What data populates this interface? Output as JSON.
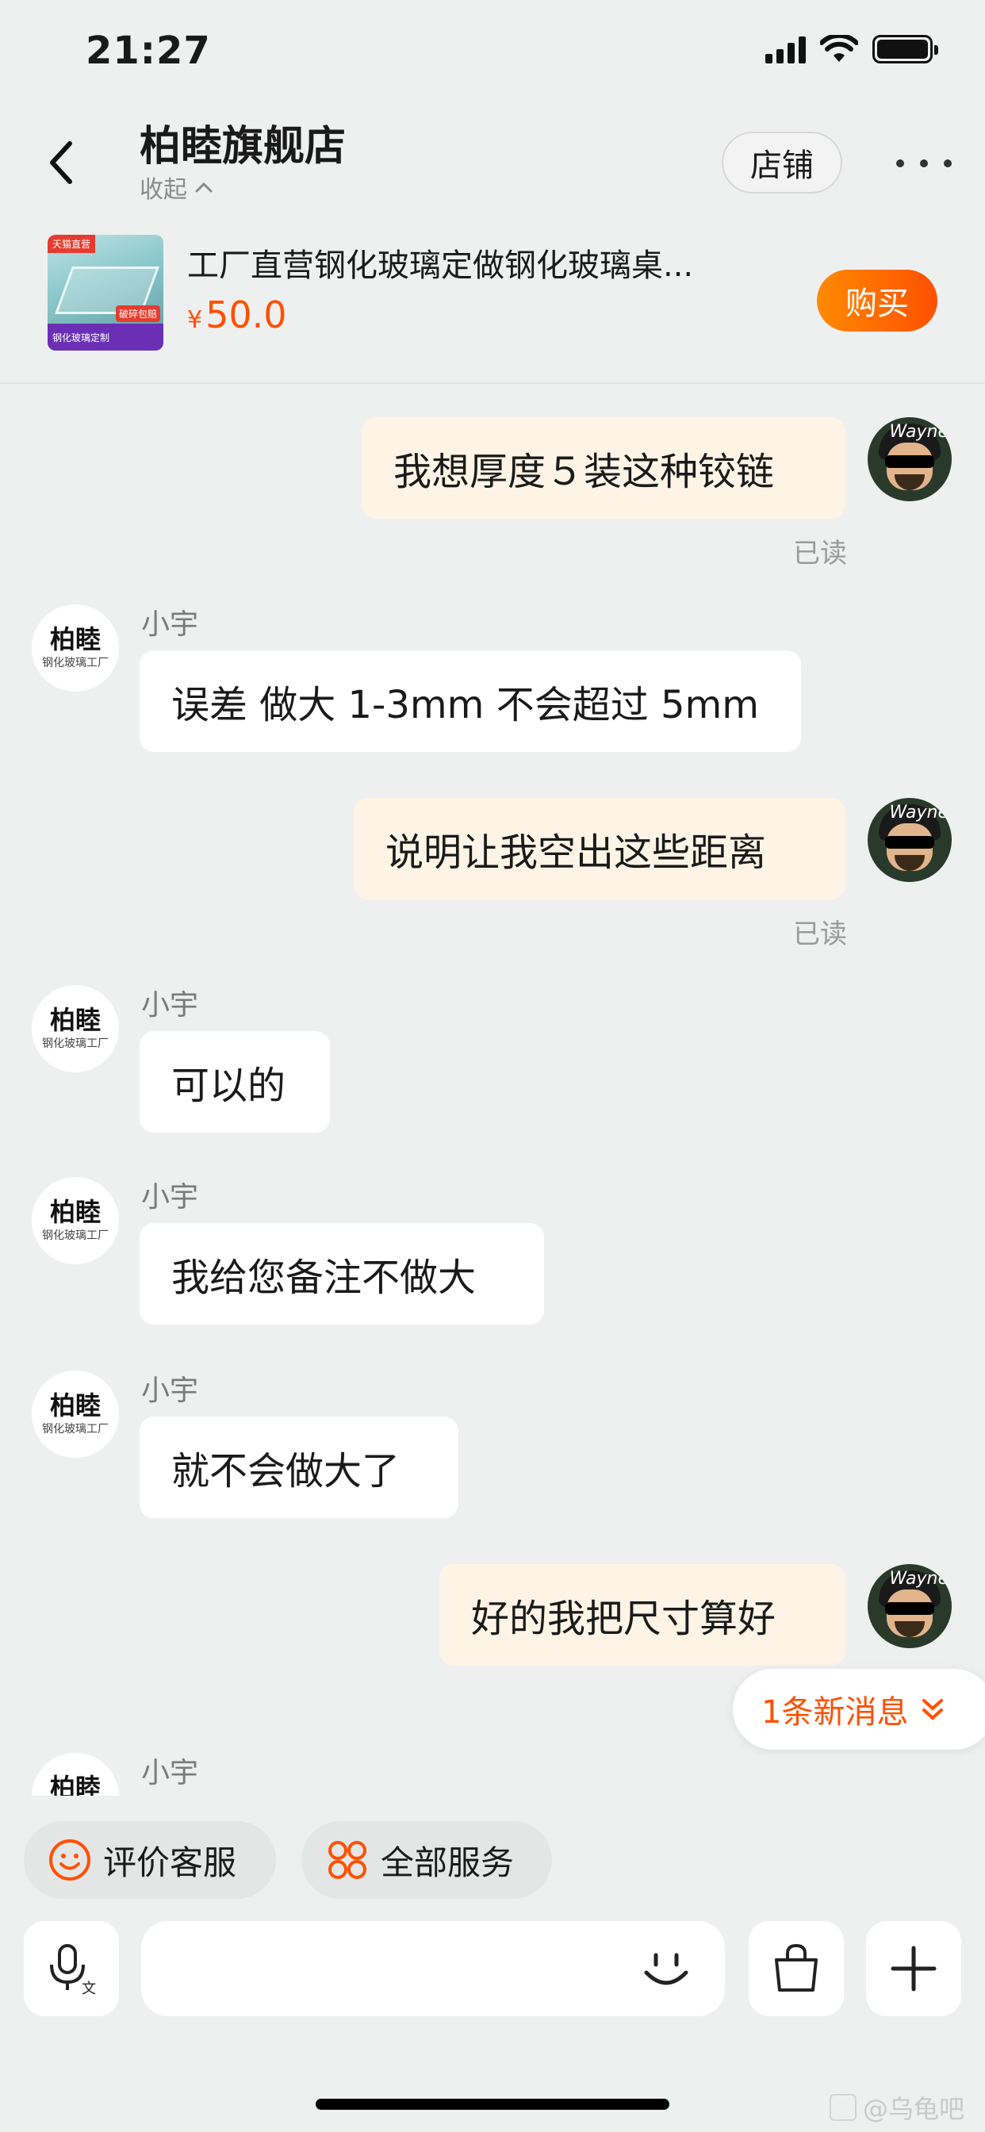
{
  "status": {
    "time": "21:27"
  },
  "header": {
    "title": "柏睦旗舰店",
    "collapse_label": "收起",
    "store_label": "店铺"
  },
  "product": {
    "name": "工厂直营钢化玻璃定做钢化玻璃桌...",
    "currency": "¥",
    "price": "50.0",
    "buy_label": "购买",
    "thumb": {
      "tag": "天猫直营",
      "band": "钢化玻璃定制",
      "badge": "破碎包赔"
    }
  },
  "me": {
    "avatar_sig": "Wayne"
  },
  "shop_avatar": {
    "line1": "柏睦",
    "line2": "钢化玻璃工厂"
  },
  "messages": [
    {
      "from": "me",
      "text": "我想厚度５装这种铰链",
      "status": "已读"
    },
    {
      "from": "them",
      "sender": "小宇",
      "text": "误差 做大 1-3mm 不会超过 5mm"
    },
    {
      "from": "me",
      "text": "说明让我空出这些距离",
      "status": "已读"
    },
    {
      "from": "them",
      "sender": "小宇",
      "text": "可以的"
    },
    {
      "from": "them",
      "sender": "小宇",
      "text": "我给您备注不做大"
    },
    {
      "from": "them",
      "sender": "小宇",
      "text": "就不会做大了"
    },
    {
      "from": "me",
      "text": "好的我把尺寸算好"
    },
    {
      "from": "them",
      "sender": "小宇",
      "text": ""
    }
  ],
  "new_messages_label": "1条新消息",
  "quick_actions": {
    "rate": "评价客服",
    "all": "全部服务"
  },
  "input": {
    "placeholder": ""
  },
  "colors": {
    "accent": "#ff5000",
    "me_bubble": "#fdf4e6",
    "background": "#eef0f0"
  },
  "watermark": "@乌龟吧"
}
